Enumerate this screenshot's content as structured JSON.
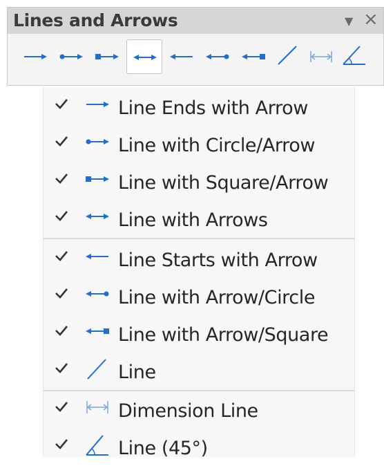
{
  "panel": {
    "title": "Lines and Arrows",
    "menu_arrow": "▼",
    "close": "×"
  },
  "toolbar": {
    "buttons": [
      {
        "name": "line-ends-with-arrow-tool",
        "icon": "line-ends-arrow-icon"
      },
      {
        "name": "line-circle-arrow-tool",
        "icon": "line-circle-arrow-icon"
      },
      {
        "name": "line-square-arrow-tool",
        "icon": "line-square-arrow-icon"
      },
      {
        "name": "line-with-arrows-tool",
        "icon": "line-arrows-icon",
        "active": true
      },
      {
        "name": "line-starts-with-arrow-tool",
        "icon": "line-starts-arrow-icon"
      },
      {
        "name": "line-arrow-circle-tool",
        "icon": "line-arrow-circle-icon"
      },
      {
        "name": "line-arrow-square-tool",
        "icon": "line-arrow-square-icon"
      },
      {
        "name": "line-tool",
        "icon": "line-icon"
      },
      {
        "name": "dimension-line-tool",
        "icon": "dimension-line-icon"
      },
      {
        "name": "line-45-tool",
        "icon": "line-45-icon"
      }
    ]
  },
  "menu": {
    "items": [
      {
        "label": "Line Ends with Arrow",
        "icon": "line-ends-arrow-icon",
        "checked": true
      },
      {
        "label": "Line with Circle/Arrow",
        "icon": "line-circle-arrow-icon",
        "checked": true
      },
      {
        "label": "Line with Square/Arrow",
        "icon": "line-square-arrow-icon",
        "checked": true
      },
      {
        "label": "Line with Arrows",
        "icon": "line-arrows-icon",
        "checked": true
      },
      {
        "label": "Line Starts with Arrow",
        "icon": "line-starts-arrow-icon",
        "checked": true
      },
      {
        "label": "Line with Arrow/Circle",
        "icon": "line-arrow-circle-icon",
        "checked": true
      },
      {
        "label": "Line with Arrow/Square",
        "icon": "line-arrow-square-icon",
        "checked": true
      },
      {
        "label": "Line",
        "icon": "line-icon",
        "checked": true
      },
      {
        "label": "Dimension Line",
        "icon": "dimension-line-icon",
        "checked": true
      },
      {
        "label": "Line (45°)",
        "icon": "line-45-icon",
        "checked": true
      }
    ]
  },
  "colors": {
    "icon_blue": "#1e6fd0",
    "title_bar": "#d6d6d6",
    "menu_bg": "#f7f7f7"
  }
}
